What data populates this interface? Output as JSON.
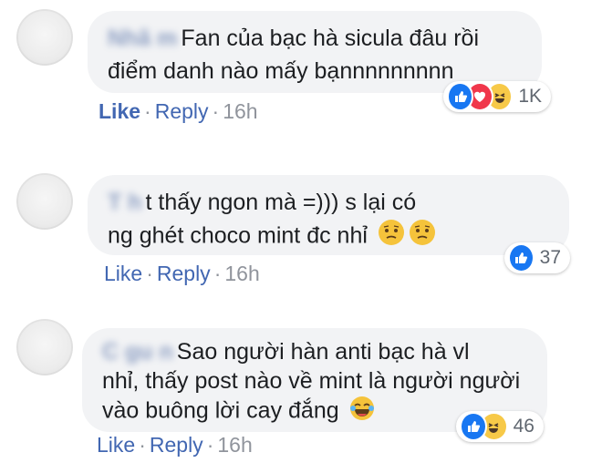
{
  "comments": [
    {
      "author": "Nhã m",
      "text_line1": "Fan của bạc hà sicula đâu rồi",
      "text_line2": "điểm danh nào mấy bạnnnnnnnnn",
      "like": "Like",
      "reply": "Reply",
      "sep": "·",
      "time": "16h",
      "reactions": [
        "like-icon",
        "love-icon",
        "haha-icon"
      ],
      "reaction_count": "1K"
    },
    {
      "author": "T h",
      "text_line1": "t thấy ngon mà =))) s lại có",
      "text_line2": "ng ghét choco mint đc nhỉ",
      "like": "Like",
      "reply": "Reply",
      "sep": "·",
      "time": "16h",
      "reactions": [
        "like-icon"
      ],
      "reaction_count": "37"
    },
    {
      "author": "C gu n",
      "text_line1": "Sao người hàn anti bạc hà vl",
      "text_line2": "nhỉ, thấy post nào về mint là người người",
      "text_line3": "vào buông lời cay đắng",
      "like": "Like",
      "reply": "Reply",
      "sep": "·",
      "time": "16h",
      "reactions": [
        "like-icon",
        "haha-icon"
      ],
      "reaction_count": "46"
    }
  ],
  "colors": {
    "link": "#4267b2",
    "bubble": "#f2f3f5",
    "like_blue": "#1877f2",
    "love_red": "#f0374b",
    "haha_yellow": "#f7c948"
  }
}
